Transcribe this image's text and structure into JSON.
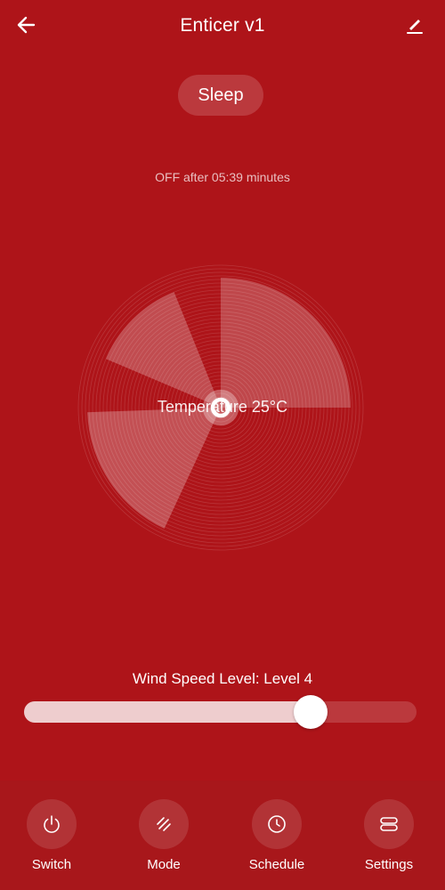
{
  "header": {
    "title": "Enticer v1",
    "back_icon": "arrow-left-icon",
    "edit_icon": "pencil-icon"
  },
  "mode": {
    "label": "Sleep"
  },
  "timer": {
    "text": "OFF after 05:39 minutes"
  },
  "fan": {
    "temperature_text": "Temperature 25°C",
    "icon": "fan-blades-icon"
  },
  "wind_speed": {
    "label": "Wind Speed Level: Level 4",
    "level_fraction": 0.73
  },
  "bottom_nav": {
    "items": [
      {
        "label": "Switch",
        "icon": "power-icon"
      },
      {
        "label": "Mode",
        "icon": "mode-slashes-icon"
      },
      {
        "label": "Schedule",
        "icon": "clock-icon"
      },
      {
        "label": "Settings",
        "icon": "settings-toggles-icon"
      }
    ]
  },
  "colors": {
    "background": "#AE1419",
    "bottom_bar": "#A8171B",
    "accent": "#FFFFFF"
  }
}
